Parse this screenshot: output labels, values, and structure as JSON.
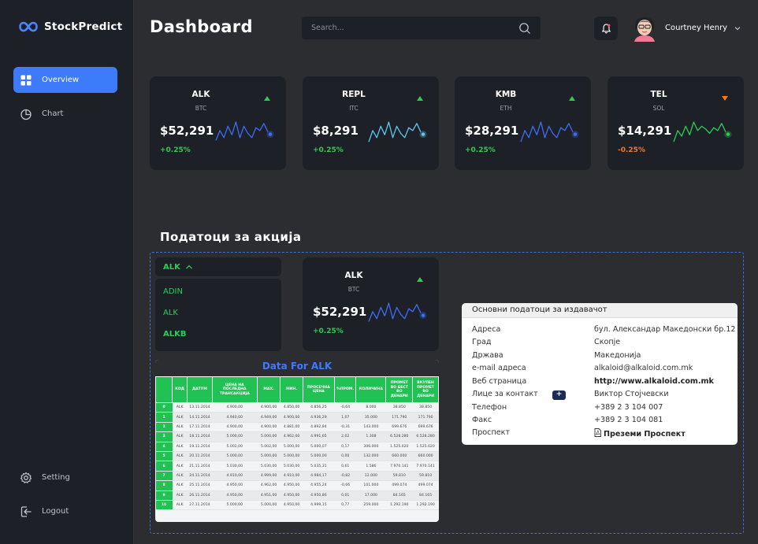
{
  "app": {
    "name": "StockPredict"
  },
  "sidebar": {
    "items": [
      {
        "label": "Overview"
      },
      {
        "label": "Chart"
      },
      {
        "label": "Setting"
      },
      {
        "label": "Logout"
      }
    ]
  },
  "header": {
    "title": "Dashboard",
    "search_placeholder": "Search...",
    "user_name": "Courtney Henry"
  },
  "colors": {
    "accent": "#3e7bfa",
    "up": "#2ecc55",
    "down": "#f07a2b",
    "panel": "#1d2027",
    "bg": "#2b2d31"
  },
  "cards": [
    {
      "symbol": "ALK",
      "sub": "BTC",
      "price": "$52,291",
      "change": "+0.25%",
      "trend": "up",
      "line_color": "#3e6cf5",
      "spark": [
        0.35,
        0.7,
        0.45,
        0.85,
        0.55,
        1.0,
        0.45,
        0.85,
        0.6,
        0.45,
        0.8,
        0.7,
        0.95,
        0.65
      ]
    },
    {
      "symbol": "REPL",
      "sub": "ITC",
      "price": "$8,291",
      "change": "+0.25%",
      "trend": "up",
      "line_color": "#5ec8f0",
      "spark": [
        0.3,
        0.7,
        0.45,
        0.85,
        0.55,
        1.0,
        0.45,
        0.85,
        0.6,
        0.45,
        0.8,
        0.7,
        0.95,
        0.65
      ]
    },
    {
      "symbol": "KMB",
      "sub": "ETH",
      "price": "$28,291",
      "change": "+0.25%",
      "trend": "up",
      "line_color": "#3e6cf5",
      "spark": [
        0.3,
        0.7,
        0.45,
        0.85,
        0.55,
        1.0,
        0.45,
        0.85,
        0.6,
        0.45,
        0.8,
        0.7,
        0.95,
        0.65
      ]
    },
    {
      "symbol": "TEL",
      "sub": "SOL",
      "price": "$14,291",
      "change": "-0.25%",
      "trend": "down",
      "line_color": "#2ecc55",
      "spark": [
        0.3,
        0.7,
        0.5,
        0.85,
        0.55,
        1.0,
        0.7,
        0.85,
        0.75,
        0.6,
        0.8,
        0.7,
        0.95,
        0.65
      ]
    }
  ],
  "section": {
    "title": "Податоци за акција"
  },
  "dropdown": {
    "selected": "ALK",
    "options": [
      "ADIN",
      "ALK",
      "ALKB"
    ]
  },
  "detail_card": {
    "symbol": "ALK",
    "sub": "BTC",
    "price": "$52,291",
    "change": "+0.25%",
    "trend": "up",
    "line_color": "#3e6cf5",
    "spark": [
      0.35,
      0.7,
      0.45,
      0.85,
      0.55,
      1.0,
      0.45,
      0.85,
      0.6,
      0.45,
      0.8,
      0.7,
      0.95,
      0.65
    ]
  },
  "data_table": {
    "title": "Data For ALK",
    "headers": [
      "",
      "КОД",
      "ДАТУМ",
      "ЦЕНА НА ПОСЛЕДНА ТРАНСАКЦИЈА",
      "MAX.",
      "МИН.",
      "ПРОСЕЧНА ЦЕНА",
      "%ПРОМ.",
      "КОЛИЧИНА",
      "ПРОМЕТ ВО БЕСТ ВО ДЕНАРИ",
      "ВКУПЕН ПРОМЕТ ВО ДЕНАРИ"
    ],
    "rows": [
      [
        "0",
        "ALK",
        "13.11.2014",
        "4.900,00",
        "4.900,00",
        "4.850,00",
        "4.856,25",
        "-0,64",
        "8.000",
        "38.850",
        "38.850"
      ],
      [
        "1",
        "ALK",
        "14.11.2014",
        "4.940,00",
        "4.949,00",
        "4.900,00",
        "4.936,29",
        "1,07",
        "35.000",
        "171.790",
        "171.790"
      ],
      [
        "2",
        "ALK",
        "17.11.2014",
        "4.900,00",
        "4.900,00",
        "4.881,00",
        "4.892,84",
        "-0,31",
        "143.000",
        "699.676",
        "699.676"
      ],
      [
        "3",
        "ALK",
        "18.11.2014",
        "5.000,00",
        "5.000,00",
        "4.962,00",
        "4.991,65",
        "2,02",
        "1.308",
        "6.528.280",
        "6.528.280"
      ],
      [
        "4",
        "ALK",
        "19.11.2014",
        "5.002,00",
        "5.002,00",
        "5.000,00",
        "5.000,07",
        "0,17",
        "306.000",
        "1.525.020",
        "1.525.020"
      ],
      [
        "5",
        "ALK",
        "20.11.2014",
        "5.000,00",
        "5.000,00",
        "5.000,00",
        "5.000,00",
        "0,00",
        "132.000",
        "660.000",
        "660.000"
      ],
      [
        "6",
        "ALK",
        "21.11.2014",
        "5.030,00",
        "5.030,00",
        "5.030,00",
        "5.035,31",
        "0,61",
        "1.586",
        "7.970.141",
        "7.970.141"
      ],
      [
        "7",
        "ALK",
        "24.11.2014",
        "4.910,00",
        "4.999,00",
        "4.910,00",
        "4.984,17",
        "-0,82",
        "12.000",
        "59.810",
        "59.810"
      ],
      [
        "8",
        "ALK",
        "25.11.2014",
        "4.950,00",
        "4.962,00",
        "4.950,00",
        "4.955,24",
        "-0,66",
        "101.000",
        "499.074",
        "499.074"
      ],
      [
        "9",
        "ALK",
        "26.11.2014",
        "4.950,00",
        "4.951,00",
        "4.950,00",
        "4.950,86",
        "0,01",
        "17.000",
        "84.165",
        "84.165"
      ],
      [
        "10",
        "ALK",
        "27.11.2014",
        "5.000,00",
        "5.000,00",
        "4.950,00",
        "4.999,15",
        "0,77",
        "259.000",
        "1.292.190",
        "1.292.190"
      ]
    ]
  },
  "issuer": {
    "title": "Основни податоци за издавачот",
    "rows": [
      {
        "label": "Адреса",
        "value": "бул. Александар Македонски бр.12"
      },
      {
        "label": "Град",
        "value": "Скопје"
      },
      {
        "label": "Држава",
        "value": "Македонија"
      },
      {
        "label": "e-mail адреса",
        "value": "alkaloid@alkaloid.com.mk"
      },
      {
        "label": "Веб страница",
        "value": "http://www.alkaloid.com.mk"
      },
      {
        "label": "Лице за контакт",
        "value": "Виктор Стојчевски",
        "button": "+"
      },
      {
        "label": "Телефон",
        "value": "+389 2 3 104 007"
      },
      {
        "label": "Факс",
        "value": "+389 2 3 104 081"
      },
      {
        "label": "Проспект",
        "value": "Преземи Проспект"
      }
    ]
  }
}
